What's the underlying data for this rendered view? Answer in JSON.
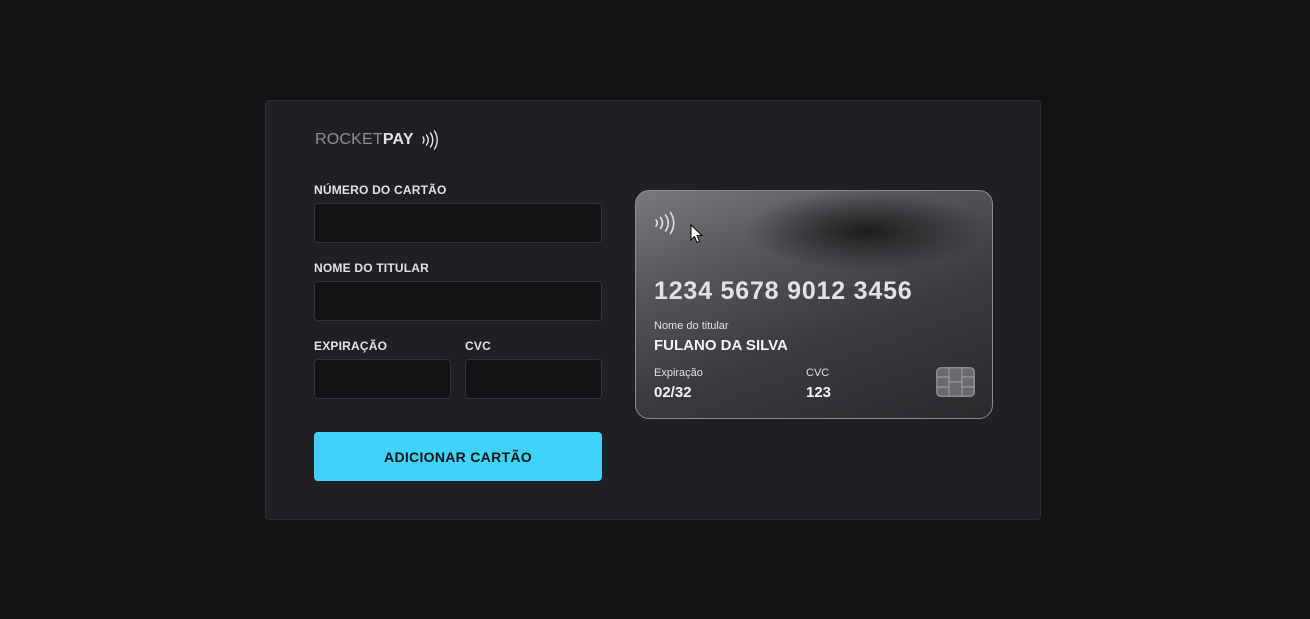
{
  "brand": {
    "name_light": "ROCKET",
    "name_bold": "PAY",
    "icon": "contactless-icon"
  },
  "form": {
    "card_number": {
      "label": "NÚMERO DO CARTÃO",
      "value": "",
      "placeholder": ""
    },
    "holder_name": {
      "label": "NOME DO TITULAR",
      "value": "",
      "placeholder": ""
    },
    "expiration": {
      "label": "EXPIRAÇÃO",
      "value": "",
      "placeholder": ""
    },
    "cvc": {
      "label": "CVC",
      "value": "",
      "placeholder": ""
    },
    "submit_label": "ADICIONAR CARTÃO"
  },
  "card_preview": {
    "number": "1234 5678 9012 3456",
    "holder_label": "Nome do titular",
    "holder_name": "FULANO DA SILVA",
    "expiration_label": "Expiração",
    "expiration": "02/32",
    "cvc_label": "CVC",
    "cvc": "123",
    "icons": [
      "contactless-icon",
      "chip-icon"
    ]
  },
  "colors": {
    "background": "#121214",
    "panel": "#202024",
    "accent": "#3fd3fc",
    "input_bg": "#121214",
    "text": "#e1e1e6"
  }
}
